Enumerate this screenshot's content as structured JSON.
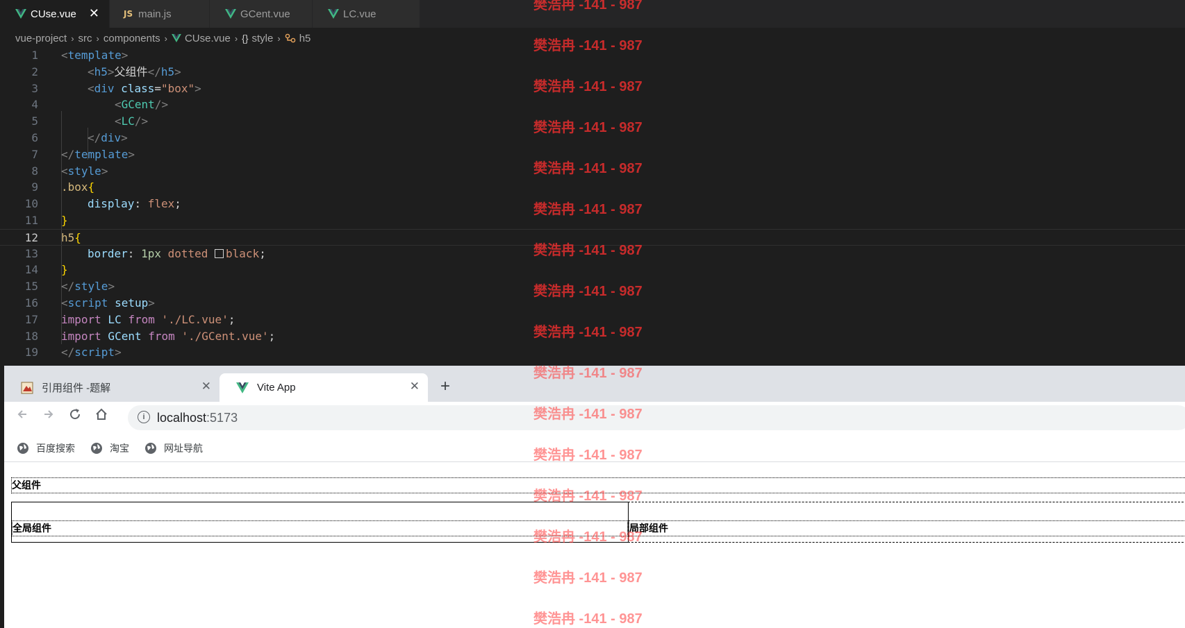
{
  "editor": {
    "tabs": [
      {
        "label": "CUse.vue",
        "icon": "vue-icon",
        "active": true,
        "close": "✕"
      },
      {
        "label": "main.js",
        "icon": "js-icon",
        "badge": "JS"
      },
      {
        "label": "GCent.vue",
        "icon": "vue-icon"
      },
      {
        "label": "LC.vue",
        "icon": "vue-icon"
      }
    ],
    "breadcrumb": [
      "vue-project",
      "src",
      "components",
      "CUse.vue",
      "style",
      "h5"
    ],
    "breadcrumb_icons": [
      "vue-icon",
      "braces-icon",
      "selector-icon"
    ],
    "line_numbers": [
      "1",
      "2",
      "3",
      "4",
      "5",
      "6",
      "7",
      "8",
      "9",
      "10",
      "11",
      "12",
      "13",
      "14",
      "15",
      "16",
      "17",
      "18",
      "19"
    ],
    "current_line": "12",
    "code": {
      "l1": [
        "<",
        "template",
        ">"
      ],
      "l2": [
        "<",
        "h5",
        ">",
        "父组件",
        "</",
        "h5",
        ">"
      ],
      "l3": [
        "<",
        "div",
        " class",
        "=",
        "\"box\"",
        ">"
      ],
      "l4": [
        "<",
        "GCent",
        "/>"
      ],
      "l5": [
        "<",
        "LC",
        "/>"
      ],
      "l6": [
        "</",
        "div",
        ">"
      ],
      "l7": [
        "</",
        "template",
        ">"
      ],
      "l8": [
        "<",
        "style",
        ">"
      ],
      "l9": [
        ".box",
        "{"
      ],
      "l10": [
        "display",
        ": ",
        "flex",
        ";"
      ],
      "l11": [
        "}"
      ],
      "l12": [
        "h5",
        "{"
      ],
      "l13": [
        "border",
        ": ",
        "1px",
        " dotted ",
        "black",
        ";"
      ],
      "l14": [
        "}"
      ],
      "l15": [
        "</",
        "style",
        ">"
      ],
      "l16": [
        "<",
        "script",
        " setup",
        ">"
      ],
      "l17": [
        "import",
        " LC ",
        "from",
        " './LC.vue'",
        ";"
      ],
      "l18": [
        "import",
        " GCent ",
        "from",
        " './GCent.vue'",
        ";"
      ],
      "l19": [
        "</",
        "script",
        ">"
      ]
    },
    "swatch_color": "#000000"
  },
  "browser": {
    "tabs": [
      {
        "label": "引用组件 -题解",
        "icon": "page-favicon-icon",
        "close": "✕"
      },
      {
        "label": "Vite App",
        "icon": "vite-favicon-icon",
        "close": "✕",
        "active": true
      }
    ],
    "new_tab": "+",
    "url_host": "localhost",
    "url_port": ":5173",
    "bookmarks": [
      "百度搜索",
      "淘宝",
      "网址导航"
    ],
    "page": {
      "heading": "父组件",
      "global_component": "全局组件",
      "local_component": "局部组件"
    }
  },
  "watermark": {
    "text": "樊浩冉 -141 - 987",
    "count": 16,
    "color": "#ff3030"
  }
}
